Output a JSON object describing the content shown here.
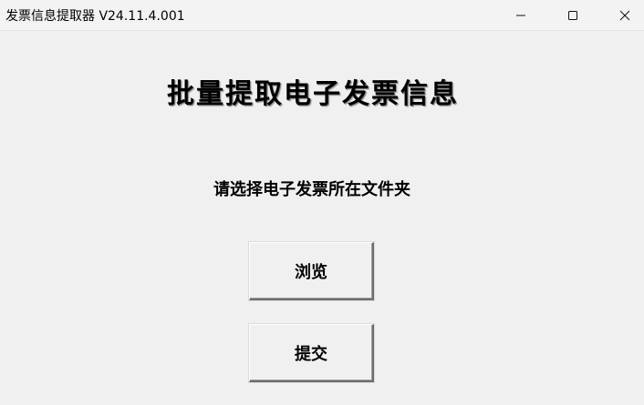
{
  "window": {
    "title": "发票信息提取器 V24.11.4.001"
  },
  "main": {
    "heading": "批量提取电子发票信息",
    "prompt": "请选择电子发票所在文件夹",
    "browse_label": "浏览",
    "submit_label": "提交"
  },
  "icons": {
    "minimize": "minimize-icon",
    "maximize": "maximize-icon",
    "close": "close-icon"
  }
}
